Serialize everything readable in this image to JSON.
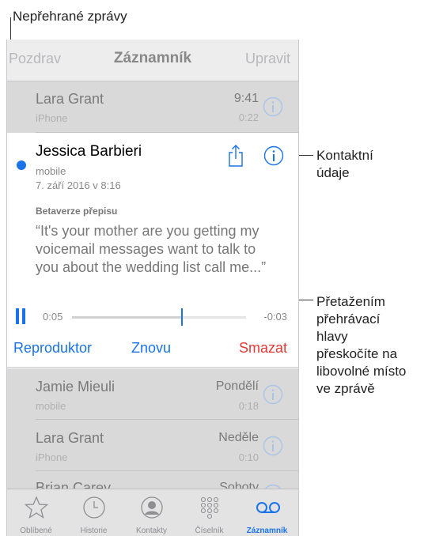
{
  "annotations": {
    "unplayed": "Nepřehrané zprávy",
    "contact_info": [
      "Kontaktní",
      "údaje"
    ],
    "scrub": [
      "Přetažením",
      "přehrávací",
      "hlavy",
      "přeskočíte na",
      "libovolné místo",
      "ve zprávě"
    ]
  },
  "navbar": {
    "left": "Pozdrav",
    "title": "Záznamník",
    "right": "Upravit"
  },
  "rows_top": [
    {
      "name": "Lara Grant",
      "label": "iPhone",
      "time": "9:41",
      "duration": "0:22"
    }
  ],
  "expanded": {
    "name": "Jessica Barbieri",
    "label": "mobile",
    "date": "7. září 2016 v 8:16",
    "beta_label": "Betaverze přepisu",
    "transcript": "“It's your mother are you getting my voicemail messages want to talk to you about the wedding list call me...”",
    "elapsed": "0:05",
    "remaining": "-0:03",
    "progress": 0.63,
    "speaker": "Reproduktor",
    "again": "Znovu",
    "delete": "Smazat"
  },
  "rows_bottom": [
    {
      "name": "Jamie Mieuli",
      "label": "mobile",
      "time": "Pondělí",
      "duration": "0:18"
    },
    {
      "name": "Lara Grant",
      "label": "iPhone",
      "time": "Neděle",
      "duration": "0:10"
    },
    {
      "name": "Brian Carey",
      "label": "",
      "time": "Soboty",
      "duration": ""
    }
  ],
  "tabs": [
    {
      "label": "Oblíbené",
      "icon": "star-icon"
    },
    {
      "label": "Historie",
      "icon": "clock-icon"
    },
    {
      "label": "Kontakty",
      "icon": "contact-icon"
    },
    {
      "label": "Číselník",
      "icon": "keypad-icon"
    },
    {
      "label": "Záznamník",
      "icon": "voicemail-icon",
      "active": true
    }
  ],
  "colors": {
    "accent": "#1a73e8",
    "destructive": "#e53935"
  }
}
